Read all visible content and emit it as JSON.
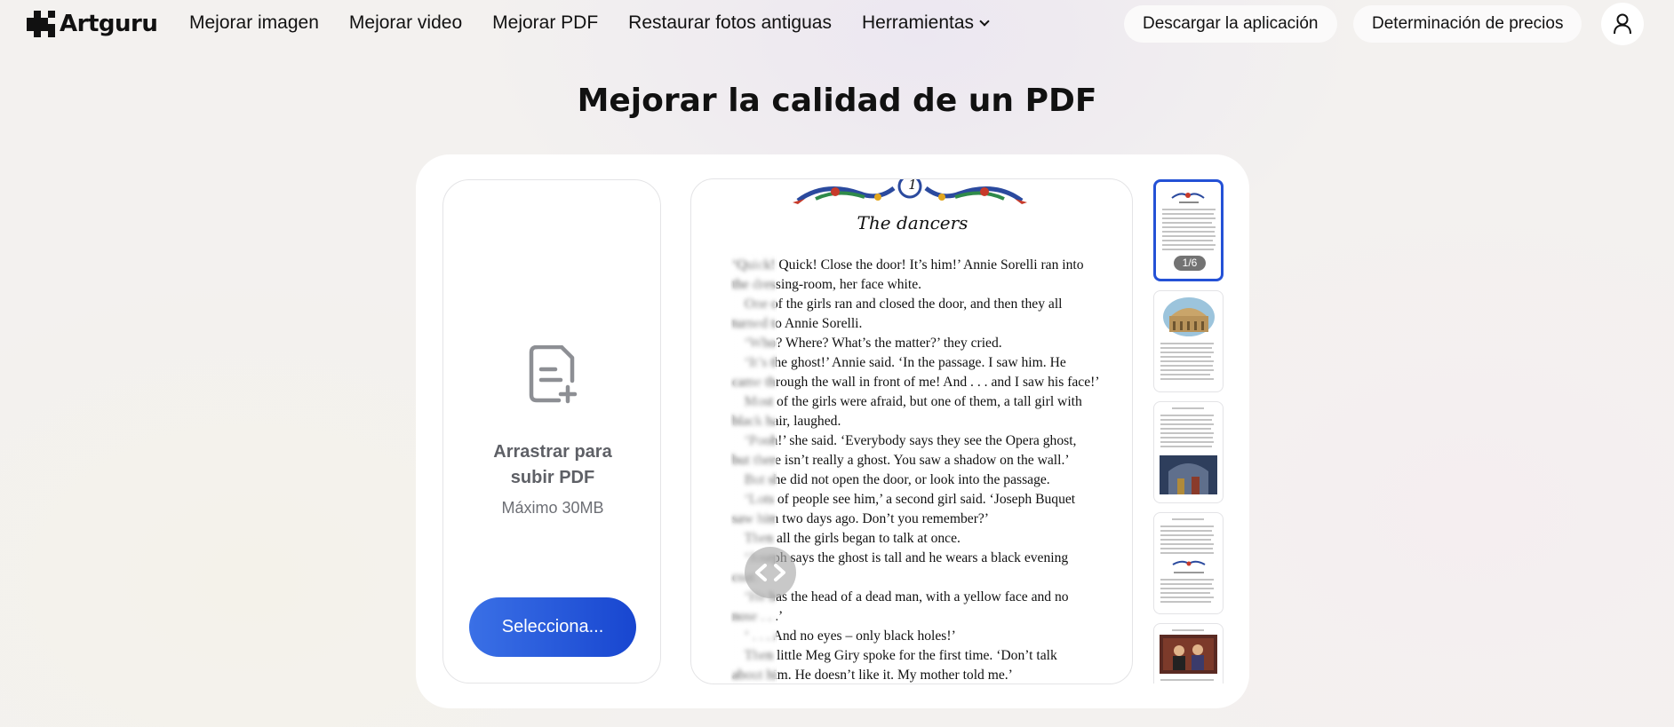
{
  "brand": {
    "name": "Artguru"
  },
  "nav": {
    "links": [
      "Mejorar imagen",
      "Mejorar video",
      "Mejorar PDF",
      "Restaurar fotos antiguas",
      "Herramientas"
    ],
    "download_app": "Descargar la aplicación",
    "pricing": "Determinación de precios"
  },
  "page": {
    "title": "Mejorar la calidad de un PDF"
  },
  "upload": {
    "drag_line1": "Arrastrar para",
    "drag_line2": "subir PDF",
    "max_size": "Máximo 30MB",
    "select_button": "Selecciona..."
  },
  "preview": {
    "chapter_number": "1",
    "chapter_title": "The dancers",
    "lines": [
      "‘Quick! Quick! Close the door! It’s him!’ Annie Sorelli ran into",
      "the dressing-room, her face white.",
      "One of the girls ran and closed the door, and then they all",
      "turned to Annie Sorelli.",
      "‘Who? Where? What’s the matter?’ they cried.",
      "‘It’s the ghost!’ Annie said. ‘In the passage. I saw him. He",
      "came through the wall in front of me! And . . . and I saw his face!’",
      "Most of the girls were afraid, but one of them, a tall girl with",
      "black hair, laughed.",
      "‘Pooh!’ she said. ‘Everybody says they see the Opera ghost,",
      "but there isn’t really a ghost. You saw a shadow on the wall.’",
      "But she did not open the door, or look into the passage.",
      "‘Lots of people see him,’ a second girl said. ‘Joseph Buquet",
      "saw him two days ago. Don’t you remember?’",
      "Then all the girls began to talk at once.",
      "‘Joseph says the ghost is tall and he wears a black evening",
      "coat.’",
      "‘He has the head of a dead man, with a yellow face and no",
      "nose . . .’",
      "‘ . . . And no eyes – only black holes!’",
      "Then little Meg Giry spoke for the first time. ‘Don’t talk",
      "about him. He doesn’t like it. My mother told me.’"
    ]
  },
  "thumbnails": {
    "page_indicator": "1/6",
    "count": 5
  },
  "icons": {
    "logo": "artguru-logo-icon",
    "chevron": "chevron-down-icon",
    "user": "user-icon",
    "upload": "document-add-icon",
    "compare": "compare-arrows-icon"
  },
  "colors": {
    "accent": "#2451d6",
    "button_start": "#3a70e6",
    "button_end": "#1846d0"
  }
}
